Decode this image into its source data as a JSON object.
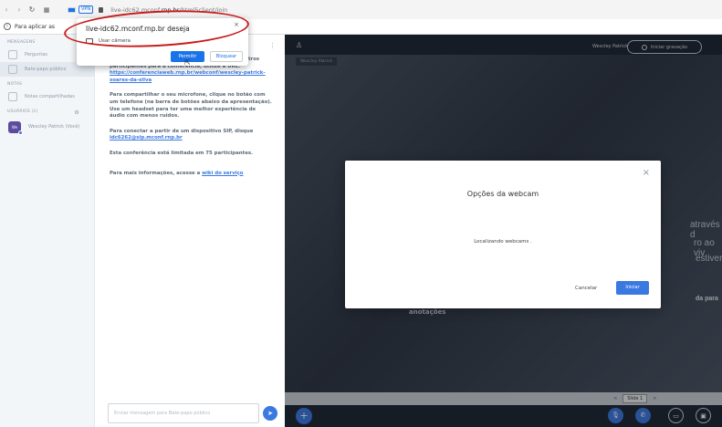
{
  "browser": {
    "url_host": "live-idc62.mconf.rnp.br",
    "url_path": "/html5client/join",
    "url_prefix": "live-idc62.mconf",
    "url_domain": ".rnp.br",
    "vpn_badge": "VPN",
    "bookmark_text": "Para aplicar as"
  },
  "permission": {
    "title": "live-idc62.mconf.rnp.br deseja",
    "item": "Usar câmera",
    "allow": "Permitir",
    "block": "Bloquear",
    "close": "×"
  },
  "left_panel": {
    "section_messages": "MENSAGENS",
    "item_questions": "Perguntas",
    "item_public_chat": "Bate-papo público",
    "section_notes": "NOTAS",
    "item_shared_notes": "Notas compartilhadas",
    "section_users": "USUÁRIOS (1)",
    "user_name": "Wescley Patrick (Você)",
    "user_initials": "We"
  },
  "chat": {
    "msg1": "Bem-vindo(a) a Wescley Patrick! Para convidar outros participantes para a conferência, utilize a URL:",
    "msg1_link": "https://conferenciaweb.rnp.br/webconf/wescley-patrick-soares-da-silva",
    "msg2": "Para compartilhar o seu microfone, clique no botão com um telefone (na barra de botões abaixo da apresentação). Use um headset para ter uma melhor experiência de áudio com menos ruídos.",
    "msg3_a": "Para conectar a partir de um dispositivo SIP, disque",
    "msg3_link": "idc6262@sip.mconf.rnp.br",
    "msg4": "Esta conferência está limitada em 75 participantes.",
    "msg5_a": "Para mais informações, acesse a",
    "msg5_link": "wiki do serviço",
    "input_placeholder": "Enviar mensagem para Bate-papo público",
    "send_icon": "➤"
  },
  "presentation": {
    "top_user": "Wescley Patrick",
    "user_tag": "Wescley Patrick",
    "record_label": "Iniciar gravação",
    "slide_text1": "através d",
    "slide_text2": "ro ao viv",
    "slide_text3": "estiver.",
    "slide_text4": "da para",
    "annotations": "anotações",
    "slide_selector": "Slide 1",
    "prev_icon": "<",
    "next_icon": ">"
  },
  "webcam_modal": {
    "title": "Opções da webcam",
    "status": "Localizando webcams .",
    "cancel": "Cancelar",
    "start": "Iniciar",
    "close": "×"
  }
}
